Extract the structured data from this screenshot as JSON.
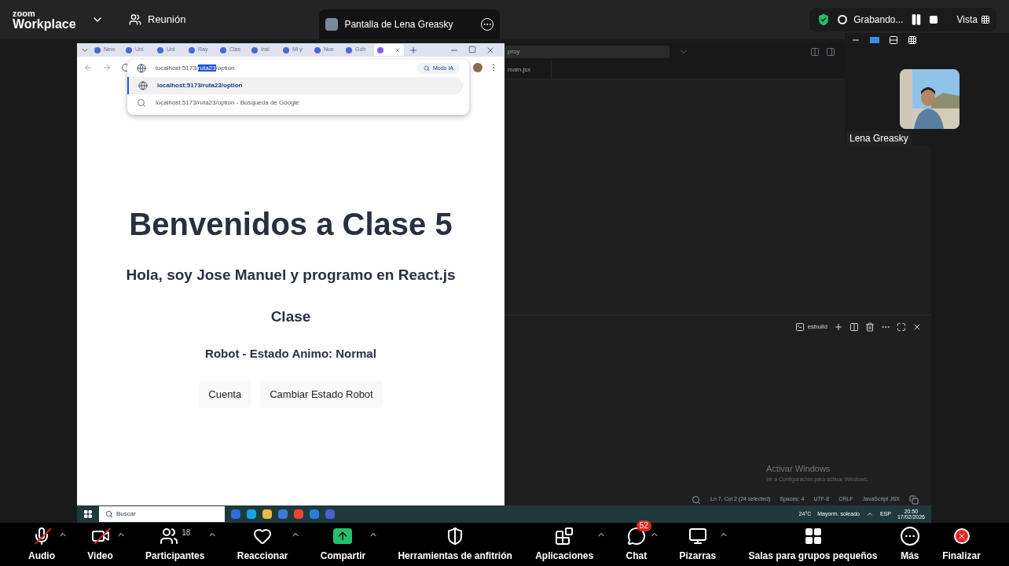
{
  "top_bar": {
    "brand_small": "zoom",
    "brand": "Workplace",
    "meeting": "Reunión",
    "share_tab": "Pantalla de Lena Greasky",
    "recording": "Grabando...",
    "view": "Vista"
  },
  "browser": {
    "tabs": [
      {
        "label": "New",
        "selected": false
      },
      {
        "label": "Uni",
        "selected": false
      },
      {
        "label": "Uni",
        "selected": false
      },
      {
        "label": "Ray",
        "selected": false
      },
      {
        "label": "Clas",
        "selected": false
      },
      {
        "label": "Insi",
        "selected": false
      },
      {
        "label": "Mi y",
        "selected": false
      },
      {
        "label": "Nue",
        "selected": false
      },
      {
        "label": "Goh",
        "selected": false
      },
      {
        "selected": true
      }
    ],
    "address": {
      "before": "localhost:5173/",
      "highlighted": "ruta23",
      "after": "/option"
    },
    "ai_mode": "Modo IA",
    "suggestions": [
      {
        "kind": "url",
        "text": "localhost:5173/ruta23/option",
        "selected": true
      },
      {
        "kind": "search",
        "text": "localhost:5173/ruta23/option - Búsqueda de Google",
        "selected": false
      }
    ],
    "page": {
      "heading": "Benvenidos a Clase 5",
      "subheading": "Hola, soy Jose Manuel y programo en React.js",
      "section": "Clase",
      "status": "Robot - Estado Animo: Normal",
      "buttons": [
        "Cuenta",
        "Cambiar Estado Robot"
      ]
    }
  },
  "editor": {
    "search": "proy",
    "file_tab": "main.jsx",
    "terminal": "esbuild",
    "status_items": [
      "Ln 7, Col 2 (24 selected)",
      "Spaces: 4",
      "UTF-8",
      "CRLF",
      "JavaScript JSX"
    ]
  },
  "os_notice": {
    "title": "Activar Windows",
    "text": "Ve a Configuración para activar Windows."
  },
  "taskbar": {
    "search": "Buscar",
    "temperature": "24°C",
    "weather": "Mayorm. soleado",
    "language": "ESP",
    "time": "20:50",
    "date": "17/02/2026"
  },
  "gallery": {
    "name": "Lena Greasky"
  },
  "toolbar": [
    {
      "kind": "audio",
      "label": "Audio",
      "muted": true,
      "menu": true
    },
    {
      "kind": "video",
      "label": "Video",
      "muted": true,
      "menu": true
    },
    {
      "kind": "participants",
      "label": "Participantes",
      "count": "18",
      "menu": true
    },
    {
      "kind": "react",
      "label": "Reaccionar",
      "menu": true
    },
    {
      "kind": "share",
      "label": "Compartir",
      "menu": true
    },
    {
      "kind": "host",
      "label": "Herramientas de anfitrión",
      "menu": false
    },
    {
      "kind": "apps",
      "label": "Aplicaciones",
      "menu": true
    },
    {
      "kind": "chat",
      "label": "Chat",
      "badge": "52",
      "menu": true
    },
    {
      "kind": "whiteboards",
      "label": "Pizarras",
      "menu": true
    },
    {
      "kind": "rooms",
      "label": "Salas para grupos pequeños",
      "menu": false
    },
    {
      "kind": "more",
      "label": "Más",
      "menu": false
    },
    {
      "kind": "end",
      "label": "Finalizar",
      "menu": false
    }
  ]
}
